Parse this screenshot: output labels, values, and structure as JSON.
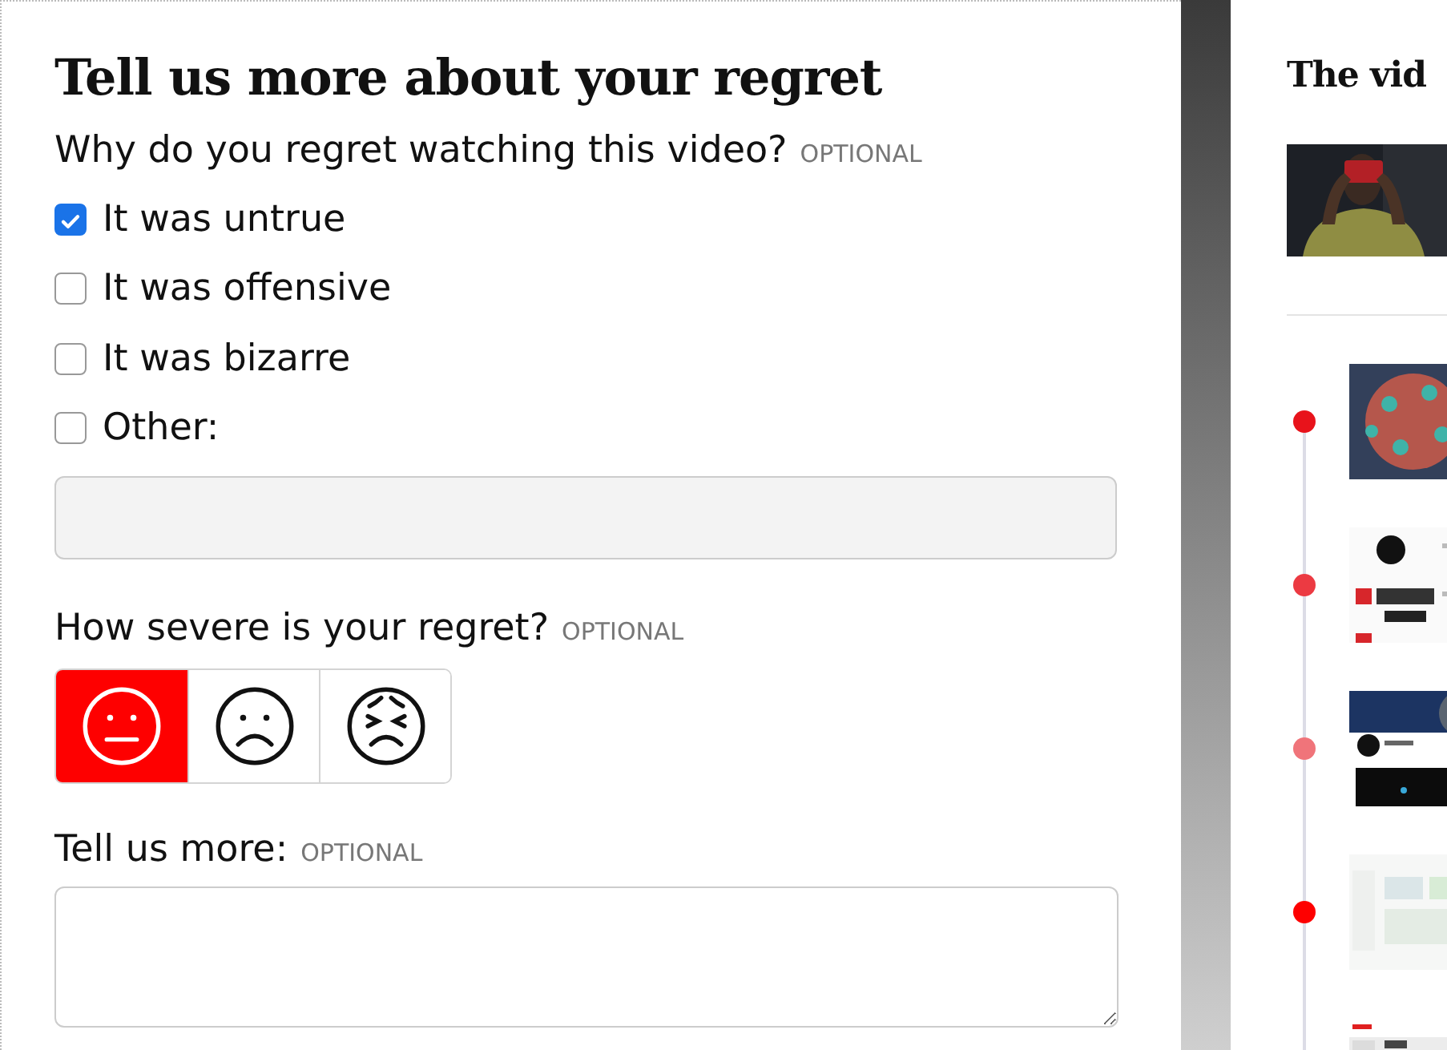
{
  "form": {
    "title": "Tell us more about your regret",
    "reasons": {
      "label": "Why do you regret watching this video?",
      "hint": "OPTIONAL",
      "options": [
        {
          "label": "It was untrue",
          "checked": true
        },
        {
          "label": "It was offensive",
          "checked": false
        },
        {
          "label": "It was bizarre",
          "checked": false
        },
        {
          "label": "Other:",
          "checked": false
        }
      ]
    },
    "severity": {
      "label": "How severe is your regret?",
      "hint": "OPTIONAL",
      "faces": [
        {
          "kind": "neutral",
          "selected": true
        },
        {
          "kind": "frown",
          "selected": false
        },
        {
          "kind": "distressed",
          "selected": false
        }
      ]
    },
    "more": {
      "label": "Tell us more:",
      "hint": "OPTIONAL"
    }
  },
  "history": {
    "title": "The vid"
  }
}
